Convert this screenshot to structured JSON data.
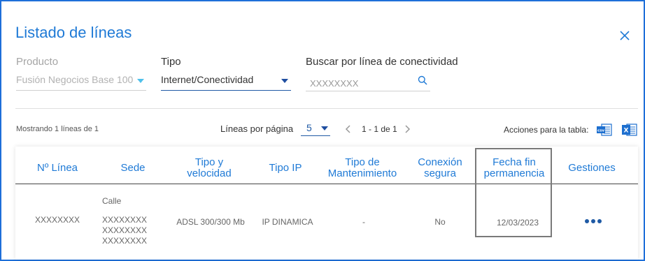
{
  "title": "Listado de líneas",
  "filters": {
    "producto": {
      "label": "Producto",
      "value": "Fusión Negocios Base 100"
    },
    "tipo": {
      "label": "Tipo",
      "value": "Internet/Conectividad"
    },
    "buscar": {
      "label": "Buscar por línea de conectividad",
      "placeholder": "XXXXXXXX"
    }
  },
  "toolbar": {
    "mostrando": "Mostrando 1 líneas de 1",
    "lineas_por_pagina_label": "Líneas por página",
    "lineas_por_pagina_value": "5",
    "page_range": "1 - 1 de 1",
    "acciones_label": "Acciones para la tabla:"
  },
  "table": {
    "headers": {
      "linea": "Nº Línea",
      "sede": "Sede",
      "tipo_velocidad": [
        "Tipo y",
        "velocidad"
      ],
      "tipo_ip": "Tipo IP",
      "mantenimiento": [
        "Tipo de",
        "Mantenimiento"
      ],
      "conexion": [
        "Conexión",
        "segura"
      ],
      "fecha_fin": [
        "Fecha fin",
        "permanencia"
      ],
      "gestiones": "Gestiones"
    },
    "rows": [
      {
        "linea": "XXXXXXXX",
        "sede": [
          "Calle",
          "XXXXXXXX",
          "XXXXXXXX",
          "XXXXXXXX"
        ],
        "tipo_velocidad": "ADSL 300/300 Mb",
        "tipo_ip": "IP DINAMICA",
        "mantenimiento": "-",
        "conexion": "No",
        "fecha_fin": "12/03/2023"
      }
    ]
  },
  "colors": {
    "accent": "#1f7ad6",
    "dark_accent": "#1f5aa5",
    "frame": "#1e6fd9",
    "excel_green": "#1d6fcf",
    "highlight_border": "#7a7a7a"
  },
  "icons": [
    "close-icon",
    "chevron-down-icon",
    "search-icon",
    "chevron-left-icon",
    "chevron-right-icon",
    "csv-export-icon",
    "excel-export-icon",
    "more-options-icon"
  ]
}
